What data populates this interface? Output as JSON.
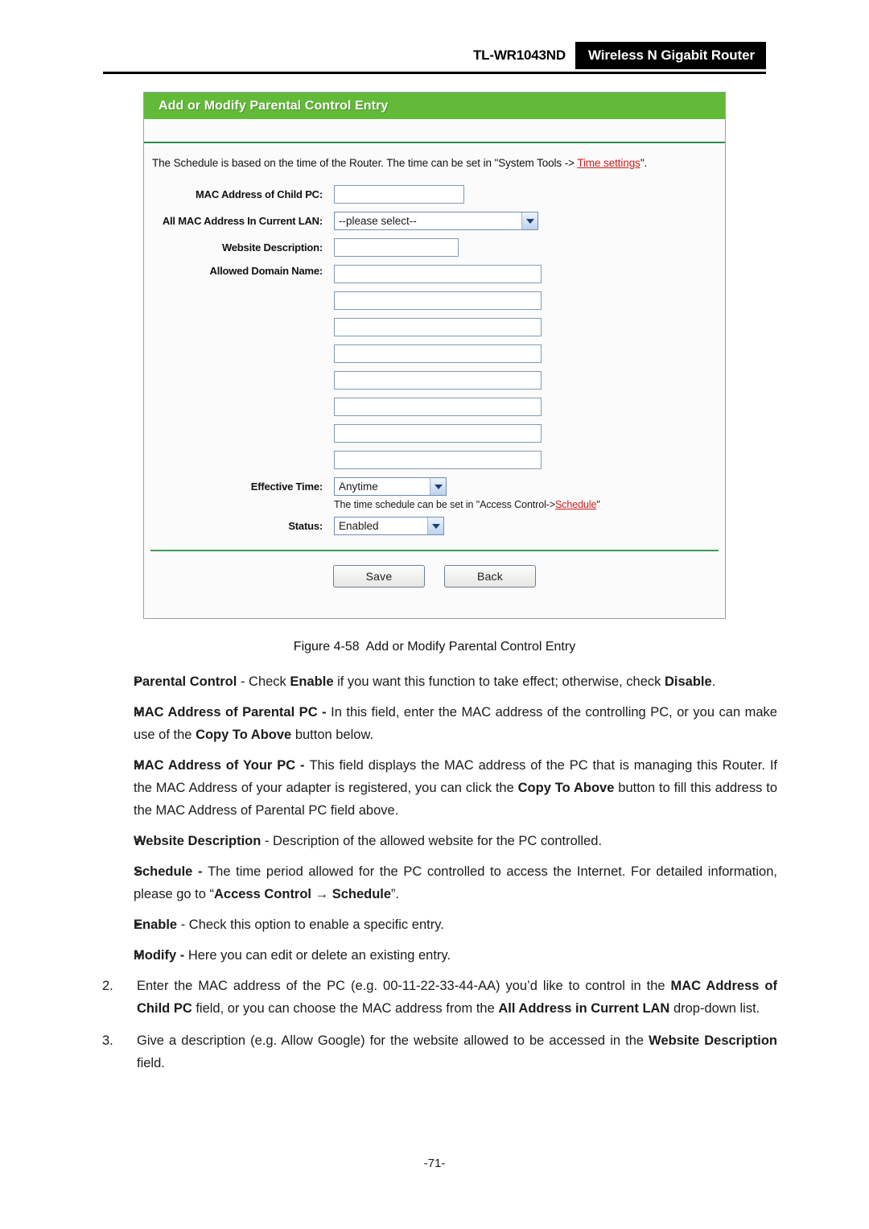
{
  "header": {
    "model": "TL-WR1043ND",
    "product": "Wireless N Gigabit Router"
  },
  "panel": {
    "title": "Add or Modify Parental Control Entry",
    "note_prefix": "The Schedule is based on the time of the Router. The time can be set in \"System Tools -> ",
    "note_link": "Time settings",
    "note_suffix": "\".",
    "fields": {
      "mac_child_label": "MAC Address of Child PC:",
      "mac_child_value": "",
      "lan_label": "All MAC Address In Current LAN:",
      "lan_value": "--please select--",
      "desc_label": "Website Description:",
      "desc_value": "",
      "domain_label": "Allowed Domain Name:",
      "domain_values": [
        "",
        "",
        "",
        "",
        "",
        "",
        "",
        ""
      ],
      "effective_time_label": "Effective Time:",
      "effective_time_value": "Anytime",
      "schedule_help_prefix": "The time schedule can be set in \"Access Control->",
      "schedule_help_link": "Schedule",
      "schedule_help_suffix": "\"",
      "status_label": "Status:",
      "status_value": "Enabled"
    },
    "buttons": {
      "save": "Save",
      "back": "Back"
    }
  },
  "figure": {
    "number": "Figure 4-58",
    "caption": "Add or Modify Parental Control Entry"
  },
  "bullets": [
    {
      "glyph": "➢",
      "html": "<b>Parental Control</b> - Check <b>Enable</b> if you want this function to take effect; otherwise, check <b>Disable</b>."
    },
    {
      "glyph": "➢",
      "html": "<b>MAC Address of Parental PC - </b>In this field, enter the MAC address of the controlling PC, or you can make use of the <b>Copy To Above</b> button below."
    },
    {
      "glyph": "➢",
      "html": "<b>MAC Address of Your PC - </b>This field displays the MAC address of the PC that is managing this Router. If the MAC Address of your adapter is registered, you can click the <b>Copy To Above</b> button to fill this address to the MAC Address of Parental PC field above."
    },
    {
      "glyph": "➢",
      "html": "<b>Website Description</b> - Description of the allowed website for the PC controlled."
    },
    {
      "glyph": "➢",
      "html": "<b>Schedule - </b>The time period allowed for the PC controlled to access the Internet. For detailed information, please go to “<b>Access Control → Schedule</b>”."
    },
    {
      "glyph": "➢",
      "html": "<b>Enable</b> - Check this option to enable a specific entry."
    },
    {
      "glyph": "➢",
      "html": "<b>Modify - </b>Here you can edit or delete an existing entry."
    }
  ],
  "numbered": [
    {
      "num": "2.",
      "html": "Enter the MAC address of the PC (e.g. 00-11-22-33-44-AA) you’d like to control in the <b>MAC Address of Child PC</b> field, or you can choose the MAC address from the <b>All Address in Current LAN</b> drop-down list."
    },
    {
      "num": "3.",
      "html": "Give a description (e.g. Allow Google) for the website allowed to be accessed in the <b>Website Description</b> field."
    }
  ],
  "page_number": "-71-",
  "colors": {
    "panel_green": "#62ba38",
    "divider_green": "#2e8b4f",
    "link_red": "#d01c1c",
    "header_black": "#000000"
  }
}
